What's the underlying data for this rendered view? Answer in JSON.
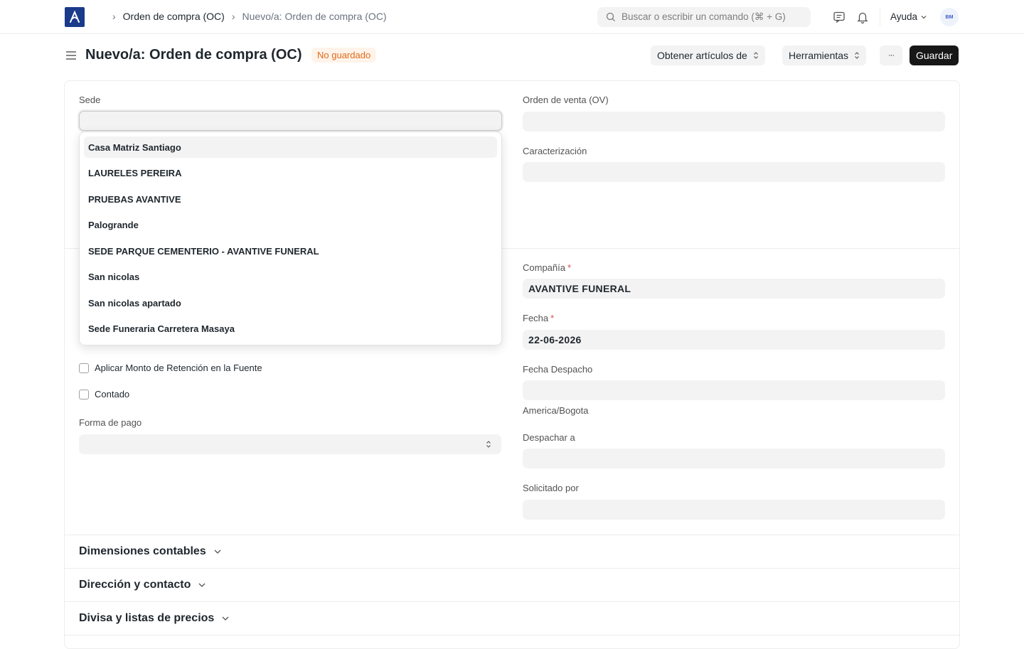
{
  "navbar": {
    "breadcrumbs": [
      "Orden de compra (OC)",
      "Nuevo/a: Orden de compra (OC)"
    ],
    "search_placeholder": "Buscar o escribir un comando (⌘ + G)",
    "help_label": "Ayuda",
    "avatar_initials": "BM"
  },
  "page": {
    "title": "Nuevo/a: Orden de compra (OC)",
    "status_badge": "No guardado",
    "actions": {
      "get_items": "Obtener artículos de",
      "tools": "Herramientas",
      "more": "···",
      "save": "Guardar"
    }
  },
  "form": {
    "sede_label": "Sede",
    "sede_value": "",
    "sales_order_label": "Orden de venta (OV)",
    "caracterizacion_label": "Caracterización",
    "company_label": "Compañía",
    "company_value": "AVANTIVE FUNERAL",
    "date_label": "Fecha",
    "date_value": "22-06-2026",
    "dispatch_date_label": "Fecha Despacho",
    "timezone_text": "America/Bogota",
    "dispatch_to_label": "Despachar a",
    "requested_by_label": "Solicitado por",
    "withholding_label": "Aplicar Monto de Retención en la Fuente",
    "cash_label": "Contado",
    "payment_method_label": "Forma de pago"
  },
  "sections": [
    "Dimensiones contables",
    "Dirección y contacto",
    "Divisa y listas de precios"
  ],
  "dropdown": {
    "options": [
      "Casa Matriz Santiago",
      "LAURELES PEREIRA",
      "PRUEBAS AVANTIVE",
      "Palogrande",
      "SEDE PARQUE CEMENTERIO - AVANTIVE FUNERAL",
      "San nicolas",
      "San nicolas apartado",
      "Sede Funeraria Carretera Masaya"
    ],
    "highlighted_index": 0
  },
  "colors": {
    "brand": "#1a3a8a",
    "badge_text": "#e0691a",
    "badge_bg": "#fff4ea",
    "primary_button": "#171717",
    "required": "#e24c4b"
  }
}
